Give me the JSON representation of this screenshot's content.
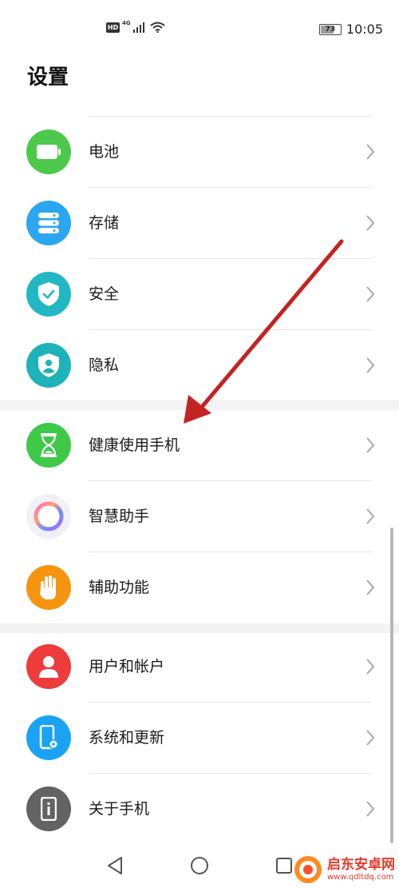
{
  "status_bar": {
    "hd": "HD",
    "network": "4G",
    "battery": "73",
    "battery_level": 0.73,
    "time": "10:05"
  },
  "page": {
    "title": "设置"
  },
  "groups": [
    {
      "items": [
        {
          "label": "电池",
          "icon": "battery-icon",
          "color": "#4cc94a"
        },
        {
          "label": "存储",
          "icon": "storage-icon",
          "color": "#2ba6f0"
        },
        {
          "label": "安全",
          "icon": "shield-check-icon",
          "color": "#21b8c4"
        },
        {
          "label": "隐私",
          "icon": "privacy-icon",
          "color": "#1db3b8"
        }
      ]
    },
    {
      "items": [
        {
          "label": "健康使用手机",
          "icon": "hourglass-icon",
          "color": "#3ec948"
        },
        {
          "label": "智慧助手",
          "icon": "assistant-ring-icon",
          "color": "#f2f0f7"
        },
        {
          "label": "辅助功能",
          "icon": "hand-icon",
          "color": "#f5940f"
        }
      ]
    },
    {
      "items": [
        {
          "label": "用户和帐户",
          "icon": "user-icon",
          "color": "#ee3b3b"
        },
        {
          "label": "系统和更新",
          "icon": "phone-settings-icon",
          "color": "#1aa3f5"
        },
        {
          "label": "关于手机",
          "icon": "phone-info-icon",
          "color": "#636363"
        }
      ]
    }
  ],
  "navigation": {
    "back": "back-icon",
    "home": "home-icon",
    "recents": "recents-icon"
  },
  "annotation": {
    "color": "#c42323"
  },
  "watermark": {
    "name": "启东安卓网",
    "url": "www.qdltdq.com"
  }
}
